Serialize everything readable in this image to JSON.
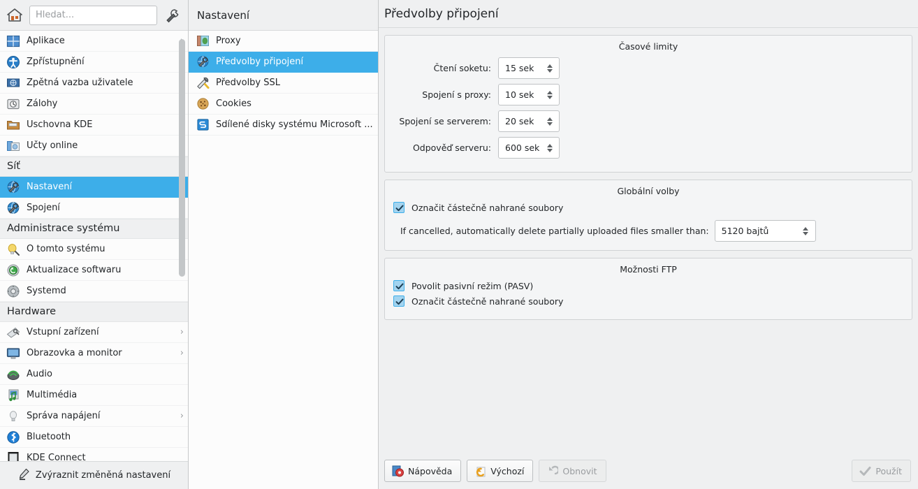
{
  "window": {
    "header_title": "Předvolby připojení"
  },
  "search": {
    "placeholder": "Hledat...",
    "value": ""
  },
  "sidebar": {
    "home_icon": "home-icon",
    "config_icon": "wrench-icon",
    "groups": [
      {
        "header": null,
        "items": [
          {
            "label": "Aplikace",
            "icon": "applications-icon",
            "arrow": "›",
            "selected": false
          },
          {
            "label": "Zpřístupnění",
            "icon": "accessibility-icon",
            "arrow": "",
            "selected": false
          },
          {
            "label": "Zpětná vazba uživatele",
            "icon": "user-feedback-icon",
            "arrow": "",
            "selected": false
          },
          {
            "label": "Zálohy",
            "icon": "backup-icon",
            "arrow": "",
            "selected": false
          },
          {
            "label": "Úschovna KDE",
            "icon": "kde-wallet-icon",
            "arrow": "",
            "selected": false
          },
          {
            "label": "Účty online",
            "icon": "online-accounts-icon",
            "arrow": "",
            "selected": false
          }
        ]
      },
      {
        "header": "Síť",
        "items": [
          {
            "label": "Nastavení",
            "icon": "network-settings-icon",
            "arrow": "›",
            "selected": true
          },
          {
            "label": "Spojení",
            "icon": "network-connections-icon",
            "arrow": "",
            "selected": false
          }
        ]
      },
      {
        "header": "Administrace systému",
        "items": [
          {
            "label": "O tomto systému",
            "icon": "about-system-icon",
            "arrow": "",
            "selected": false
          },
          {
            "label": "Aktualizace softwaru",
            "icon": "software-update-icon",
            "arrow": "",
            "selected": false
          },
          {
            "label": "Systemd",
            "icon": "systemd-icon",
            "arrow": "",
            "selected": false
          }
        ]
      },
      {
        "header": "Hardware",
        "items": [
          {
            "label": "Vstupní zařízení",
            "icon": "input-devices-icon",
            "arrow": "›",
            "selected": false
          },
          {
            "label": "Obrazovka a monitor",
            "icon": "display-monitor-icon",
            "arrow": "›",
            "selected": false
          },
          {
            "label": "Audio",
            "icon": "audio-icon",
            "arrow": "",
            "selected": false
          },
          {
            "label": "Multimédia",
            "icon": "multimedia-icon",
            "arrow": "",
            "selected": false
          },
          {
            "label": "Správa napájení",
            "icon": "power-management-icon",
            "arrow": "›",
            "selected": false
          },
          {
            "label": "Bluetooth",
            "icon": "bluetooth-icon",
            "arrow": "",
            "selected": false
          },
          {
            "label": "KDE Connect",
            "icon": "kde-connect-icon",
            "arrow": "",
            "selected": false
          }
        ]
      }
    ],
    "footer": {
      "label": "Zvýraznit změněná nastavení",
      "icon": "highlighter-icon"
    }
  },
  "midpanel": {
    "title": "Nastavení",
    "items": [
      {
        "label": "Proxy",
        "icon": "proxy-icon",
        "selected": false
      },
      {
        "label": "Předvolby připojení",
        "icon": "connection-preferences-icon",
        "selected": true
      },
      {
        "label": "Předvolby SSL",
        "icon": "ssl-preferences-icon",
        "selected": false
      },
      {
        "label": "Cookies",
        "icon": "cookies-icon",
        "selected": false
      },
      {
        "label": "Sdílené disky systému Microsoft ...",
        "icon": "smb-shares-icon",
        "selected": false
      }
    ]
  },
  "main": {
    "timeouts": {
      "title": "Časové limity",
      "fields": [
        {
          "label": "Čtení soketu:",
          "value": "15 sek"
        },
        {
          "label": "Spojení s proxy:",
          "value": "10 sek"
        },
        {
          "label": "Spojení se serverem:",
          "value": "20 sek"
        },
        {
          "label": "Odpověď serveru:",
          "value": "600 sek"
        }
      ]
    },
    "global": {
      "title": "Globální volby",
      "checkbox_label": "Označit částečně nahrané soubory",
      "checkbox_checked": true,
      "delete_label": "If cancelled, automatically delete partially uploaded files smaller than:",
      "delete_value": "5120 bajtů"
    },
    "ftp": {
      "title": "Možnosti FTP",
      "options": [
        {
          "label": "Povolit pasivní režim (PASV)",
          "checked": true
        },
        {
          "label": "Označit částečně nahrané soubory",
          "checked": true
        }
      ]
    }
  },
  "buttons": {
    "help": {
      "label": "Nápověda",
      "icon": "help-icon",
      "enabled": true
    },
    "defaults": {
      "label": "Výchozí",
      "icon": "defaults-icon",
      "enabled": true
    },
    "reset": {
      "label": "Obnovit",
      "icon": "reset-icon",
      "enabled": false
    },
    "apply": {
      "label": "Použít",
      "icon": "apply-check-icon",
      "enabled": false
    }
  },
  "colors": {
    "selection": "#3daee9",
    "window_bg": "#eff0f1",
    "view_bg": "#fcfcfc",
    "text": "#232629",
    "disabled_text": "#9a9da0"
  }
}
